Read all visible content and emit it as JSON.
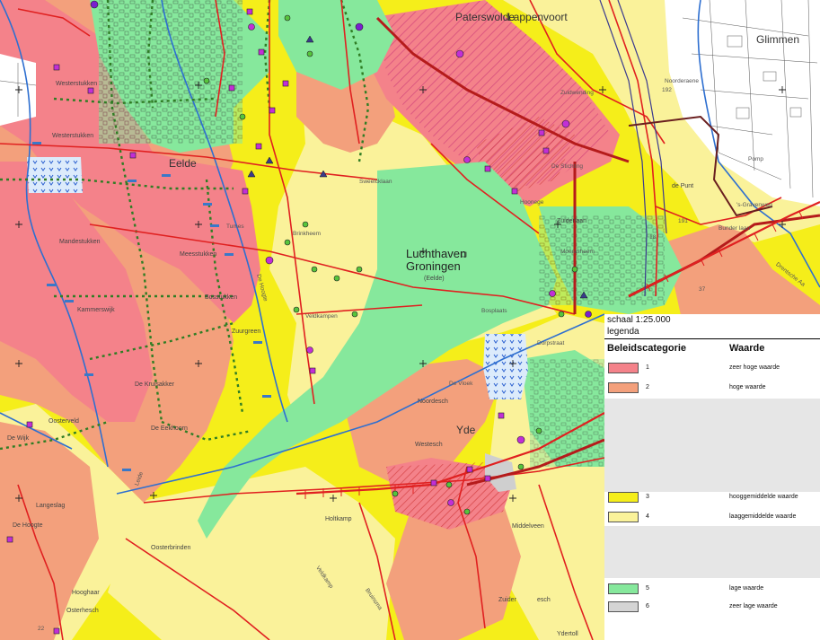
{
  "map": {
    "labels": {
      "eelde": "Eelde",
      "paterswolde": "Paterswolde",
      "lappenvoort": "Lappenvoort",
      "glimmen": "Glimmen",
      "luchthaven_1": "Luchthaven",
      "luchthaven_2": "Groningen",
      "luchthaven_3": "(Eelde)",
      "yde": "Yde",
      "de_punt": "de Punt",
      "zuiderlaan": "Zuiderlaan",
      "westerstukken": "Westerstukken",
      "westerstukk": "Westerstukken",
      "mandestukken": "Mandestukken",
      "meesstukken": "Meesstukken",
      "bosstukken": "Bosstukken",
      "kammerswijk": "Kammerswijk",
      "zuurgreen": "Zuurgreen",
      "de_kruisakker": "De Kruisakker",
      "eekhoorn": "De Eekhoorn",
      "oosterveld": "Oosterveld",
      "de_wijk": "De Wijk",
      "langeslag": "Langeslag",
      "de_hoogte": "De Hoogte",
      "hooghaar": "Hooghaar",
      "osterhesch": "Osterhesch",
      "oosterbrinden": "Oosterbrinden",
      "holtkamp": "Holtkamp",
      "noordesch": "Noordesch",
      "westesch": "Westesch",
      "middelveen": "Middelveen",
      "zuider": "Zuider",
      "esch": "esch",
      "ydertoll": "Ydertoll",
      "bosplaats": "Bosplaats",
      "dorpstraat": "Dorpstraat",
      "veldkampen": "Veldkampen",
      "sweelcklaan": "Sweelcklaan",
      "brinkheem": "Brinkheem",
      "de_stichting": "De Stichting",
      "hoonege": "Hoonege",
      "zuidwending": "Zuidwending",
      "moerasheem": "Moerasheem",
      "noorderaene": "Noorderaene",
      "pomp": "Pomp",
      "bunder_laan": "Bunder laan",
      "s_gravenweg": "'s-Gravenweg",
      "drentsche_aa": "Drentsche Aa",
      "road_22": "22",
      "road_37": "37",
      "road_18": "18",
      "road_191": "191",
      "road_192": "192",
      "leide": "Leide",
      "hoogte_2": "De Hoogte",
      "de_vloek": "De Vloek",
      "tumes": "Tumes",
      "veldkamp": "Veldkamp",
      "bruinsma": "Bruinsma"
    }
  },
  "legend": {
    "scale": "schaal 1:25.000",
    "title": "legenda",
    "col_category": "Beleidscategorie",
    "col_value": "Waarde",
    "rows": [
      {
        "num": "1",
        "desc": "zeer hoge waarde",
        "color": "#f4828a"
      },
      {
        "num": "2",
        "desc": "hoge waarde",
        "color": "#f3a07c"
      },
      {
        "num": "3",
        "desc": "hooggemiddelde waarde",
        "color": "#f5ee1a"
      },
      {
        "num": "4",
        "desc": "laaggemiddelde waarde",
        "color": "#faf29a"
      },
      {
        "num": "5",
        "desc": "lage waarde",
        "color": "#86e89c"
      },
      {
        "num": "6",
        "desc": "zeer lage waarde",
        "color": "#d4d4d4"
      }
    ]
  }
}
